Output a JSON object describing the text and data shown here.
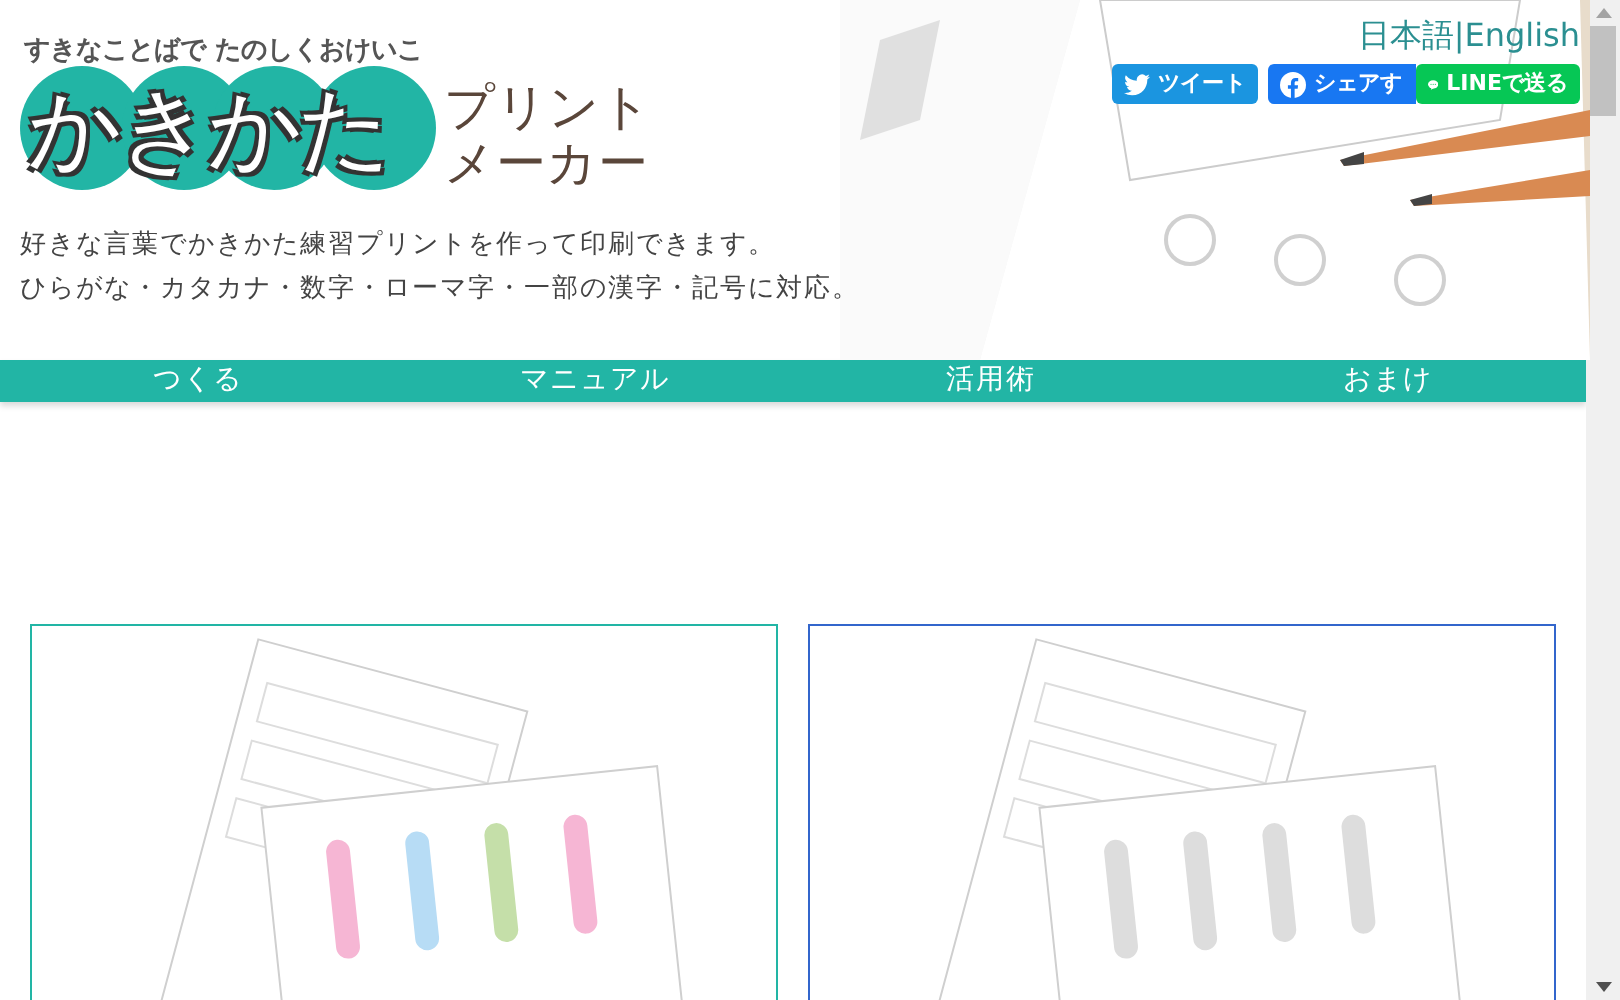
{
  "header": {
    "tagline": "すきなことばで たのしくおけいこ",
    "logo_main": "かきかた",
    "logo_sub": [
      "プリント",
      "メーカー"
    ],
    "description": [
      "好きな言葉でかきかた練習プリントを作って印刷できます。",
      "ひらがな・カタカナ・数字・ローマ字・一部の漢字・記号に対応。"
    ]
  },
  "languages": {
    "items": [
      "日本語",
      "English"
    ],
    "separator": "|"
  },
  "share_buttons": [
    {
      "kind": "twitter",
      "label": "ツイート"
    },
    {
      "kind": "facebook",
      "label": "シェアす"
    },
    {
      "kind": "line",
      "label": "LINEで送る"
    }
  ],
  "nav": [
    "つくる",
    "マニュアル",
    "活用術",
    "おまけ"
  ]
}
